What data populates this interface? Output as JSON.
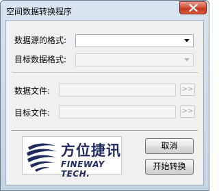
{
  "window": {
    "title": "空间数据转换程序"
  },
  "form": {
    "source_format_label": "数据源的格式:",
    "target_format_label": "目标数据格式:",
    "data_file_label": "数据文件:",
    "target_file_label": "目标文件:",
    "data_file_value": "",
    "target_file_value": "",
    "browse_label": ">>"
  },
  "logo": {
    "chinese_text": "方位捷讯",
    "english_text": "FINEWAY TECH."
  },
  "buttons": {
    "cancel_label": "取消",
    "start_label": "开始转换"
  },
  "colors": {
    "logo_blue": "#1f2a5e",
    "close_red": "#c2381e"
  }
}
